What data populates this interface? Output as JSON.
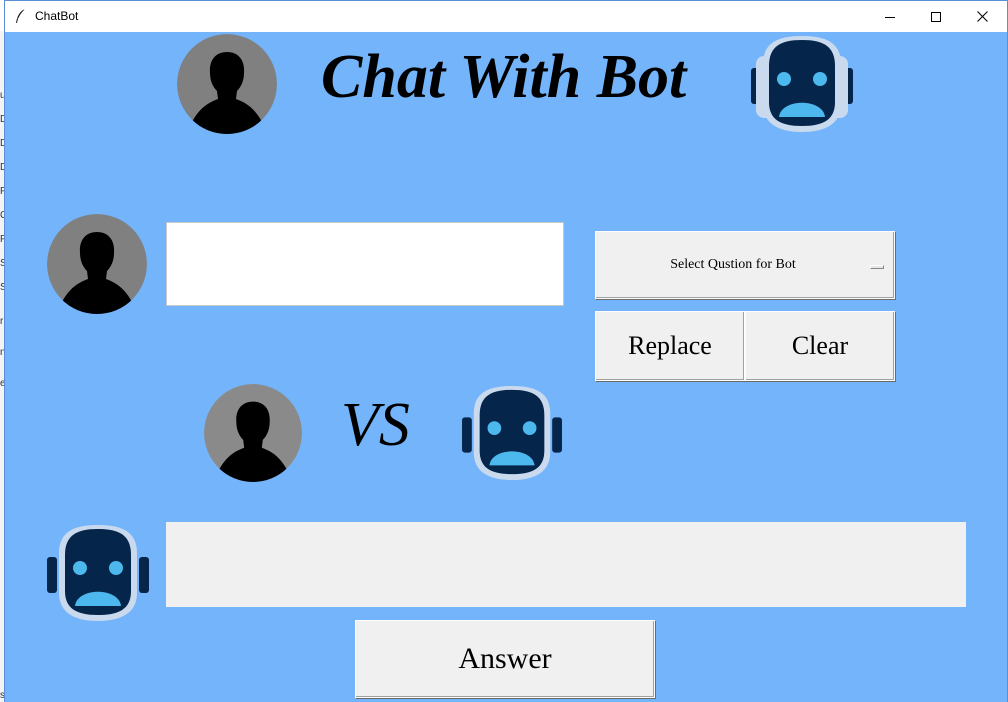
{
  "window": {
    "title": "ChatBot"
  },
  "header": {
    "title": "Chat With Bot"
  },
  "question": {
    "value": "",
    "placeholder": ""
  },
  "select_button": {
    "label": "Select Qustion for Bot"
  },
  "buttons": {
    "replace": "Replace",
    "clear": "Clear",
    "answer": "Answer"
  },
  "versus": {
    "label": "VS"
  },
  "answer": {
    "value": ""
  },
  "background_fragments": [
    "u",
    "D",
    "D",
    "D",
    "P",
    "C",
    "P",
    "S",
    "S",
    "r",
    "n",
    "e",
    "s"
  ],
  "colors": {
    "background": "#74b4fb",
    "robot_dark": "#05254a",
    "robot_eyes": "#4cb8ee",
    "robot_rim": "#c9d9ee",
    "user_circle": "#808080"
  },
  "icons": [
    "feather-icon",
    "user-avatar-icon",
    "robot-avatar-icon",
    "minimize-icon",
    "maximize-icon",
    "close-icon"
  ]
}
